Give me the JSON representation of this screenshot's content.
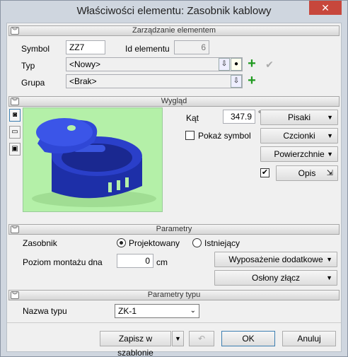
{
  "window": {
    "title": "Właściwości elementu: Zasobnik kablowy",
    "close_glyph": "✕"
  },
  "sections": {
    "management": "Zarządzanie elementem",
    "appearance": "Wygląd",
    "parameters": "Parametry",
    "type_parameters": "Parametry typu"
  },
  "management": {
    "symbol_label": "Symbol",
    "symbol_value": "ZZ7",
    "element_id_label": "Id elementu",
    "element_id_value": "6",
    "type_label": "Typ",
    "type_value": "<Nowy>",
    "group_label": "Grupa",
    "group_value": "<Brak>"
  },
  "appearance": {
    "angle_label": "Kąt",
    "angle_value": "347.9",
    "angle_unit": "°",
    "show_symbol_label": "Pokaż symbol",
    "show_symbol_checked": false,
    "pens_label": "Pisaki",
    "fonts_label": "Czcionki",
    "surfaces_label": "Powierzchnie",
    "description_label": "Opis",
    "description_checked": true
  },
  "parameters": {
    "storage_label": "Zasobnik",
    "option_designed": "Projektowany",
    "option_existing": "Istniejący",
    "selected": "designed",
    "mount_level_label": "Poziom montażu dna",
    "mount_level_value": "0",
    "mount_level_unit": "cm",
    "extra_equipment_label": "Wyposażenie dodatkowe",
    "joint_covers_label": "Osłony złącz"
  },
  "type_parameters": {
    "type_name_label": "Nazwa typu",
    "type_name_value": "ZK-1"
  },
  "footer": {
    "save_template_label": "Zapisz w szablonie",
    "ok_label": "OK",
    "cancel_label": "Anuluj"
  }
}
